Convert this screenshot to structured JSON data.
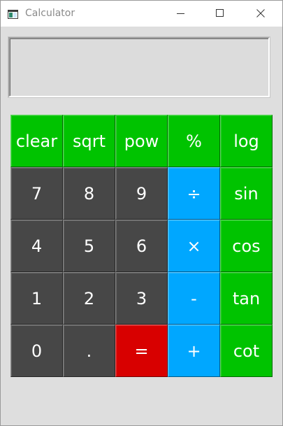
{
  "window": {
    "title": "Calculator"
  },
  "display": {
    "value": ""
  },
  "colors": {
    "function_keys": "#00c300",
    "digit_keys": "#474747",
    "operator_keys": "#00a7ff",
    "equals_key": "#d80000"
  },
  "keys": {
    "clear": "clear",
    "sqrt": "sqrt",
    "pow": "pow",
    "percent": "%",
    "log": "log",
    "seven": "7",
    "eight": "8",
    "nine": "9",
    "divide": "÷",
    "sin": "sin",
    "four": "4",
    "five": "5",
    "six": "6",
    "multiply": "×",
    "cos": "cos",
    "one": "1",
    "two": "2",
    "three": "3",
    "minus": "-",
    "tan": "tan",
    "zero": "0",
    "dot": ".",
    "equals": "=",
    "plus": "+",
    "cot": "cot"
  }
}
